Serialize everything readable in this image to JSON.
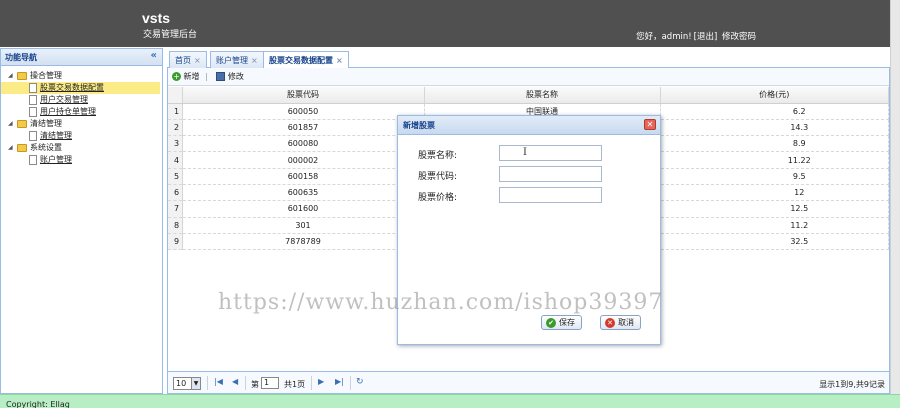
{
  "header": {
    "app_title": "vsts",
    "subtitle": "交易管理后台",
    "greeting": "您好，admin!",
    "logout": "[退出]",
    "change_password": "修改密码"
  },
  "sidebar": {
    "title": "功能导航",
    "collapse_icon": "double-chevron-left-icon",
    "groups": [
      {
        "label": "操合管理",
        "items": [
          "股票交易数据配置",
          "用户交易管理",
          "用户持仓单管理"
        ]
      },
      {
        "label": "清结管理",
        "items": [
          "清结管理"
        ]
      },
      {
        "label": "系统设置",
        "items": [
          "账户管理"
        ]
      }
    ],
    "selected_item": "股票交易数据配置"
  },
  "tabs": [
    {
      "label": "首页",
      "close": "×"
    },
    {
      "label": "账户管理",
      "close": "×"
    },
    {
      "label": "股票交易数据配置",
      "close": "×"
    }
  ],
  "toolbar": {
    "add_label": "新增",
    "separator": "|",
    "edit_label": "修改"
  },
  "grid": {
    "columns": [
      "股票代码",
      "股票名称",
      "价格(元)"
    ],
    "rows": [
      {
        "num": "1",
        "code": "600050",
        "name": "中国联通",
        "price": "6.2"
      },
      {
        "num": "2",
        "code": "601857",
        "name": "",
        "price": "14.3"
      },
      {
        "num": "3",
        "code": "600080",
        "name": "",
        "price": "8.9"
      },
      {
        "num": "4",
        "code": "000002",
        "name": "",
        "price": "11.22"
      },
      {
        "num": "5",
        "code": "600158",
        "name": "",
        "price": "9.5"
      },
      {
        "num": "6",
        "code": "600635",
        "name": "",
        "price": "12"
      },
      {
        "num": "7",
        "code": "601600",
        "name": "",
        "price": "12.5"
      },
      {
        "num": "8",
        "code": "301",
        "name": "",
        "price": "11.2"
      },
      {
        "num": "9",
        "code": "7878789",
        "name": "",
        "price": "32.5"
      }
    ]
  },
  "pager": {
    "page_size": "10",
    "page_prefix": "第",
    "current_page": "1",
    "page_suffix": "共1页",
    "info": "显示1到9,共9记录"
  },
  "dialog": {
    "title": "新增股票",
    "close_icon": "close-icon",
    "fields": [
      {
        "label": "股票名称:",
        "value": ""
      },
      {
        "label": "股票代码:",
        "value": ""
      },
      {
        "label": "股票价格:",
        "value": ""
      }
    ],
    "save_label": "保存",
    "cancel_label": "取消"
  },
  "watermark": "https://www.huzhan.com/ishop39397",
  "footer": {
    "copyright": "Copyright: Ellag"
  }
}
